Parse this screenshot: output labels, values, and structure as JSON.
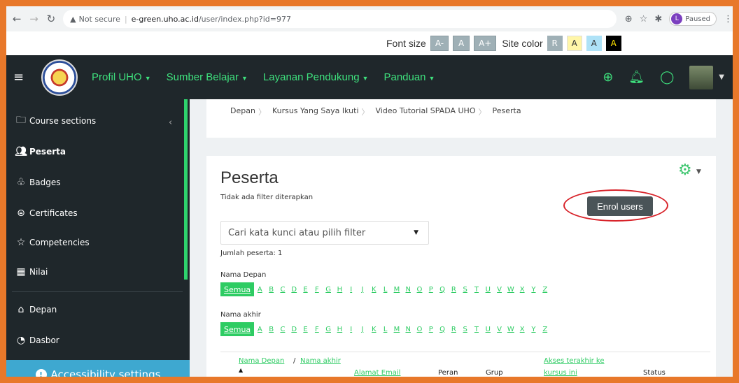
{
  "browser": {
    "security_label": "Not secure",
    "host": "e-green.uho.ac.id",
    "path": "/user/index.php?id=977",
    "profile_initial": "L",
    "profile_status": "Paused"
  },
  "fontbar": {
    "font_size_label": "Font size",
    "font_buttons": [
      "A-",
      "A",
      "A+"
    ],
    "site_color_label": "Site color",
    "color_buttons": [
      "R",
      "A",
      "A",
      "A"
    ]
  },
  "navbar": {
    "menu": [
      "Profil UHO",
      "Sumber Belajar",
      "Layanan Pendukung",
      "Panduan"
    ]
  },
  "sidebar": {
    "items": [
      "Course sections",
      "Peserta",
      "Badges",
      "Certificates",
      "Competencies",
      "Nilai",
      "Depan",
      "Dasbor"
    ],
    "accessibility": "Accessibility settings"
  },
  "breadcrumb": [
    "Depan",
    "Kursus Yang Saya Ikuti",
    "Video Tutorial SPADA UHO",
    "Peserta"
  ],
  "participants": {
    "title": "Peserta",
    "no_filter": "Tidak ada filter diterapkan",
    "enrol_button": "Enrol users",
    "filter_placeholder": "Cari kata kunci atau pilih filter",
    "count": "Jumlah peserta: 1",
    "first_name_label": "Nama Depan",
    "last_name_label": "Nama akhir",
    "all_label": "Semua",
    "letters": [
      "A",
      "B",
      "C",
      "D",
      "E",
      "F",
      "G",
      "H",
      "I",
      "J",
      "K",
      "L",
      "M",
      "N",
      "O",
      "P",
      "Q",
      "R",
      "S",
      "T",
      "U",
      "V",
      "W",
      "X",
      "Y",
      "Z"
    ],
    "columns": {
      "first_name": "Nama Depan",
      "slash": "/",
      "last_name": "Nama akhir",
      "email": "Alamat Email",
      "role": "Peran",
      "group": "Grup",
      "last_access_1": "Akses terakhir ke",
      "last_access_2": "kursus ini",
      "status": "Status"
    }
  }
}
